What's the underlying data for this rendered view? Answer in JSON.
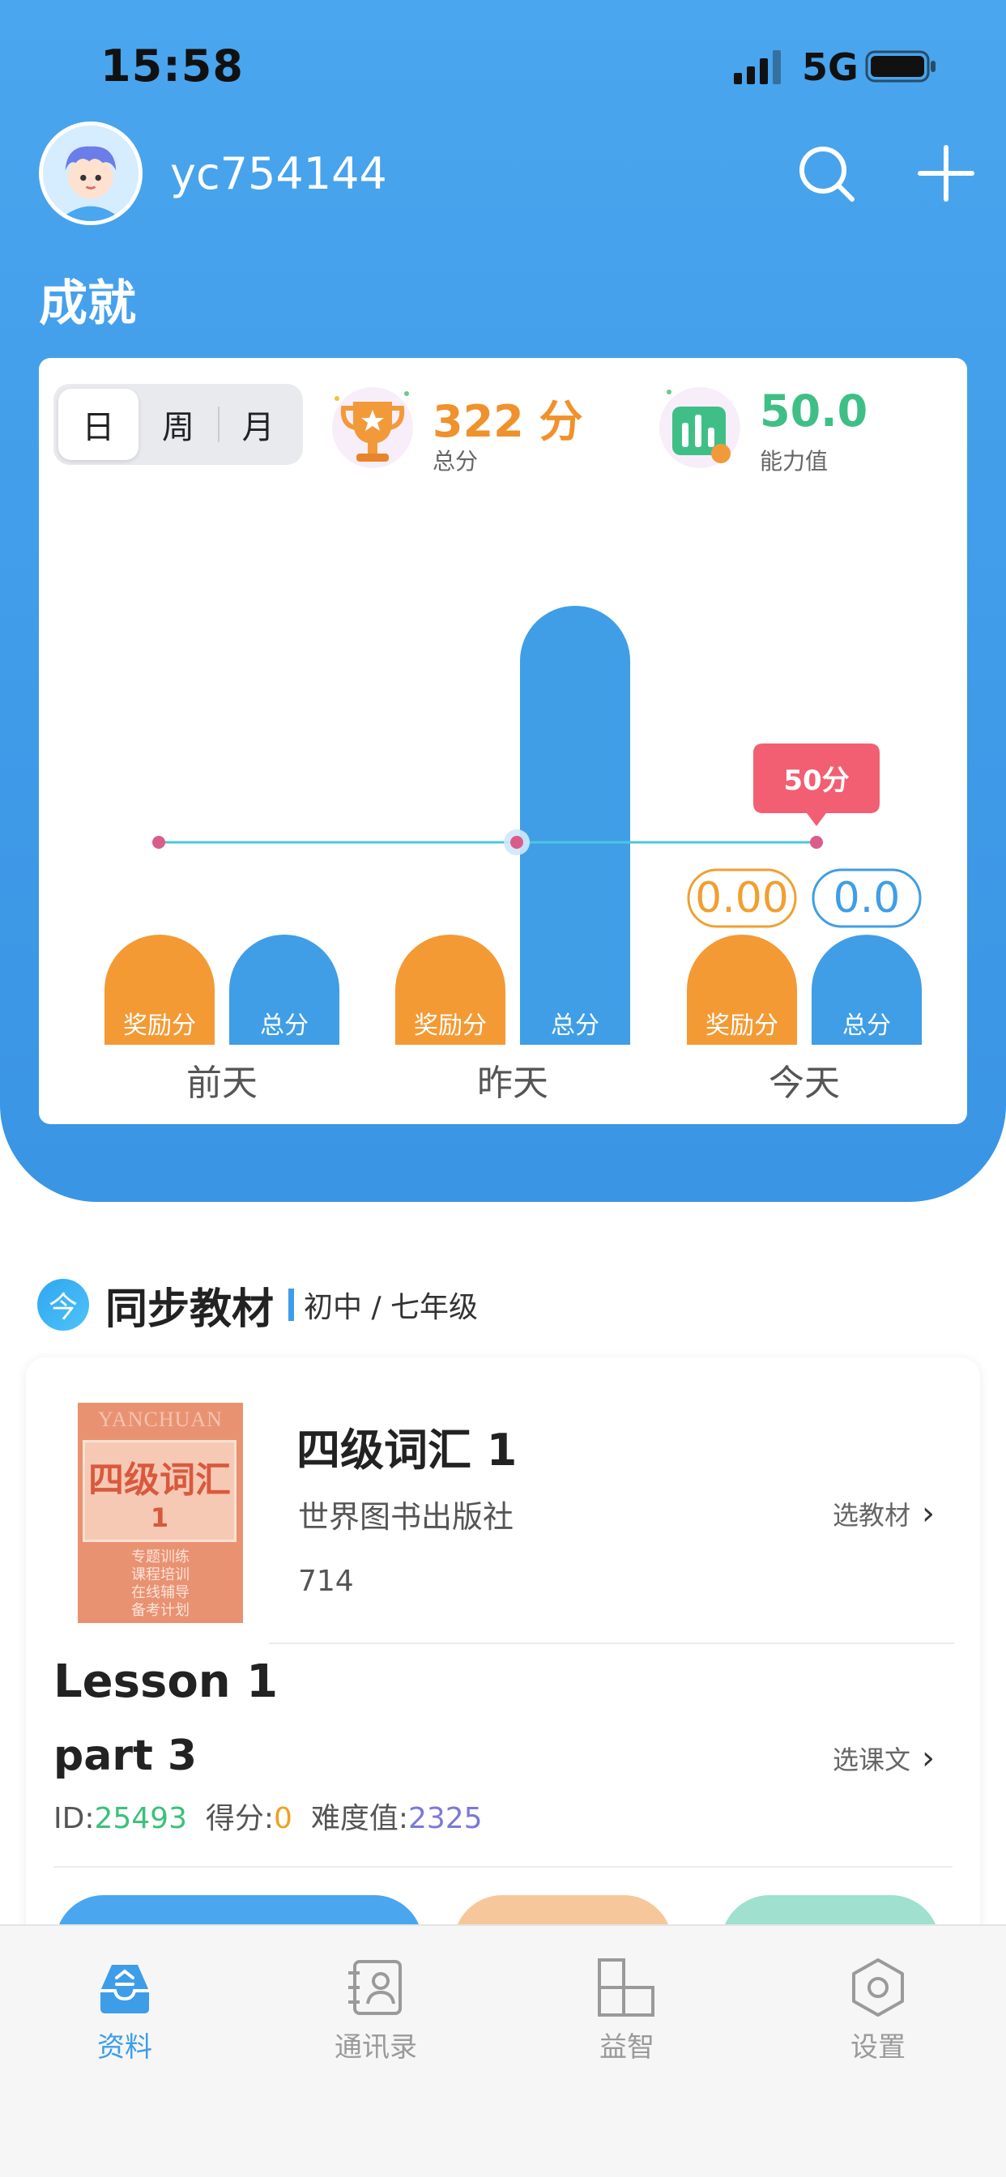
{
  "status_bar": {
    "time": "15:58",
    "network": "5G"
  },
  "profile": {
    "username": "yc754144"
  },
  "achievement": {
    "title": "成就",
    "tabs": [
      "日",
      "周",
      "月"
    ],
    "active_tab": "日",
    "total_points": {
      "value": "322 分",
      "label": "总分"
    },
    "ability": {
      "value": "50.0",
      "label": "能力值"
    }
  },
  "chart_data": {
    "type": "bar",
    "categories": [
      "前天",
      "昨天",
      "今天"
    ],
    "series": [
      {
        "name": "奖励分",
        "values": [
          0,
          0,
          0
        ],
        "color": "#f39a34"
      },
      {
        "name": "总分",
        "values": [
          0,
          322,
          0
        ],
        "color": "#3f9ee6"
      }
    ],
    "line": {
      "values": [
        50,
        50,
        50
      ],
      "color": "#4cc6e0"
    },
    "tooltip": {
      "category": "今天",
      "text": "50分"
    },
    "today_labels": {
      "bonus": "0.00",
      "total": "0.0"
    },
    "bar_labels": {
      "bonus": "奖励分",
      "total": "总分"
    }
  },
  "sync": {
    "icon_char": "今",
    "title": "同步教材",
    "grade": "初中 / 七年级",
    "book": {
      "cover_top": "YANCHUAN",
      "cover_title": "四级词汇",
      "cover_num": "1",
      "cover_lines": [
        "专题训练",
        "课程培训",
        "在线辅导",
        "备考计划"
      ],
      "title": "四级词汇 1",
      "publisher": "世界图书出版社",
      "count": "714",
      "select_label": "选教材"
    },
    "lesson": {
      "title": "Lesson 1",
      "part": "part 3",
      "id_label": "ID:",
      "id_value": "25493",
      "score_label": "得分:",
      "score_value": "0",
      "difficulty_label": "难度值:",
      "difficulty_value": "2325",
      "select_label": "选课文"
    }
  },
  "tabbar": {
    "items": [
      {
        "label": "资料",
        "icon": "inbox-icon",
        "active": true
      },
      {
        "label": "通讯录",
        "icon": "contacts-icon",
        "active": false
      },
      {
        "label": "益智",
        "icon": "puzzle-icon",
        "active": false
      },
      {
        "label": "设置",
        "icon": "settings-icon",
        "active": false
      }
    ],
    "active_color": "#3e9de8",
    "inactive_color": "#9a9a9a"
  }
}
